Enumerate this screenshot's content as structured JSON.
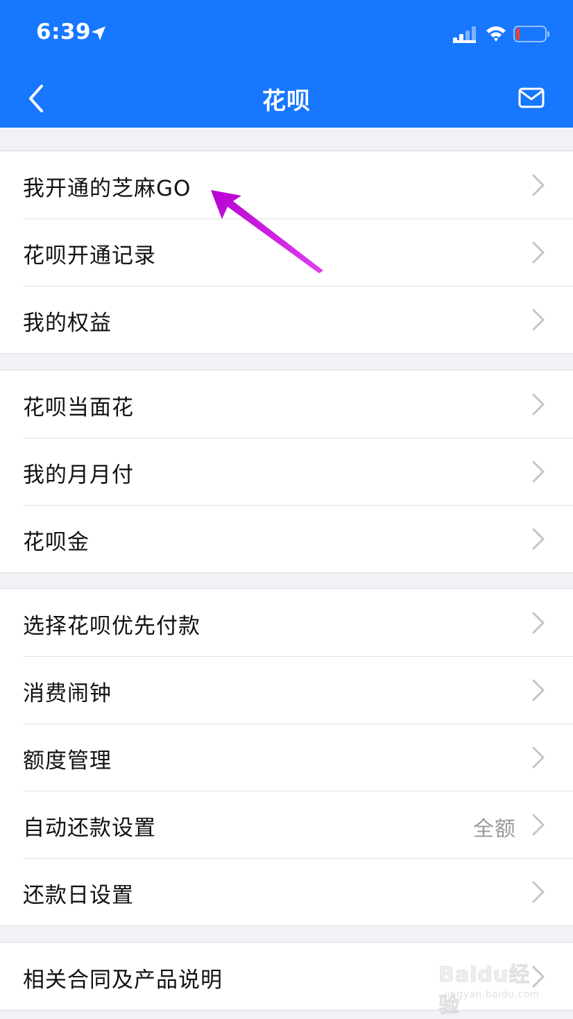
{
  "status_bar": {
    "time": "6:39"
  },
  "nav": {
    "title": "花呗"
  },
  "sections": [
    {
      "items": [
        {
          "label": "我开通的芝麻GO"
        },
        {
          "label": "花呗开通记录"
        },
        {
          "label": "我的权益"
        }
      ]
    },
    {
      "items": [
        {
          "label": "花呗当面花"
        },
        {
          "label": "我的月月付"
        },
        {
          "label": "花呗金"
        }
      ]
    },
    {
      "items": [
        {
          "label": "选择花呗优先付款"
        },
        {
          "label": "消费闹钟"
        },
        {
          "label": "额度管理"
        },
        {
          "label": "自动还款设置",
          "value": "全额"
        },
        {
          "label": "还款日设置"
        }
      ]
    },
    {
      "items": [
        {
          "label": "相关合同及产品说明"
        }
      ]
    }
  ],
  "watermark": {
    "brand": "Baidu经验",
    "url": "jingyan.baidu.com"
  },
  "colors": {
    "header_blue": "#1777ff",
    "annotation_arrow": "#c81ed2",
    "page_bg": "#f2f2f6"
  }
}
